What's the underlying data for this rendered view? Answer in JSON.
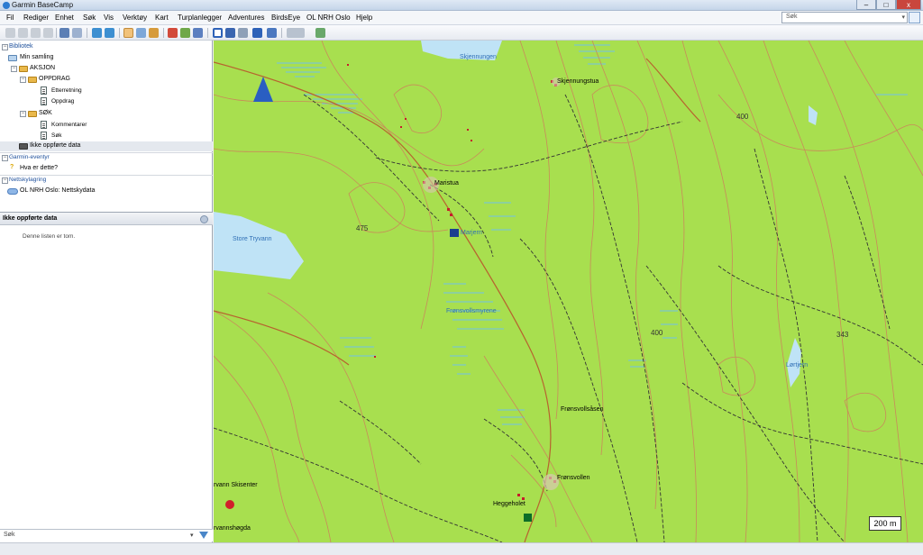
{
  "window": {
    "title": "Garmin BaseCamp",
    "minimize": "–",
    "maximize": "□",
    "close": "x"
  },
  "menu": [
    "Fil",
    "Rediger",
    "Enhet",
    "Søk",
    "Vis",
    "Verktøy",
    "Kart",
    "Turplanlegger",
    "Adventures",
    "BirdsEye",
    "OL NRH Oslo",
    "Hjelp"
  ],
  "top_search": {
    "placeholder": "Søk"
  },
  "library": {
    "section": "Bibliotek",
    "my_collection": "Min samling",
    "folder_aksjon": "AKSJON",
    "folder_oppdrag": "OPPDRAG",
    "item_etterretning": "Etterretning",
    "item_oppdrag": "Oppdrag",
    "folder_sok": "SØK",
    "item_kommentarer": "Kommentarer",
    "item_sok": "Søk",
    "unlisted": "Ikke oppførte data"
  },
  "adventures": {
    "section": "Garmin-eventyr",
    "item": "Hva er dette?"
  },
  "cloud": {
    "section": "Nettskylagring",
    "item": "OL NRH Oslo: Nettskydata"
  },
  "lower_panel": {
    "title": "Ikke oppførte data",
    "empty": "Denne listen er tom."
  },
  "bottom_search": {
    "placeholder": "Søk"
  },
  "map": {
    "labels": {
      "skjennungen": "Skjennungen",
      "skjennungstua": "Skjennungstua",
      "maristua": "Maristua",
      "store_tryvann": "Store Tryvann",
      "frensvollsmyrene": "Frønsvollsmyrene",
      "frensvollsasen": "Frønsvollsåsen",
      "frensvollen": "Frønsvollen",
      "heggeholet": "Heggeholet",
      "lortjern": "Lørtjern",
      "skisenter": "rvann Skisenter",
      "vannshogda": "rvannshøgda",
      "marjern": "Marjern"
    },
    "elevations": {
      "e475": "475",
      "e400a": "400",
      "e400b": "400",
      "e343": "343"
    },
    "scale": "200 m",
    "colors": {
      "forest": "#a8df4f",
      "water": "#bfe3f6",
      "contour": "#c98a5a",
      "path": "#333333"
    }
  }
}
